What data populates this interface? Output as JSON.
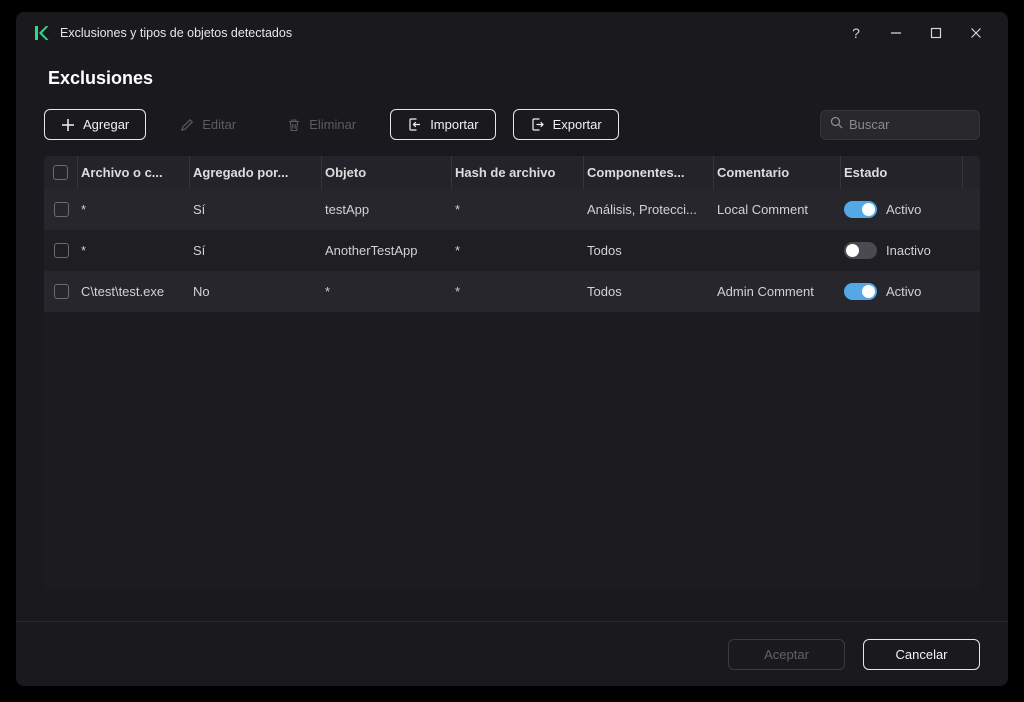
{
  "window": {
    "title": "Exclusiones y tipos de objetos detectados",
    "help_label": "?"
  },
  "page": {
    "title": "Exclusiones"
  },
  "toolbar": {
    "add_label": "Agregar",
    "edit_label": "Editar",
    "delete_label": "Eliminar",
    "import_label": "Importar",
    "export_label": "Exportar",
    "search_placeholder": "Buscar"
  },
  "table": {
    "columns": [
      "Archivo o c...",
      "Agregado por...",
      "Objeto",
      "Hash de archivo",
      "Componentes...",
      "Comentario",
      "Estado"
    ],
    "rows": [
      {
        "file": "*",
        "added_by": "Sí",
        "object": "testApp",
        "hash": "*",
        "components": "Análisis, Protecci...",
        "comment": "Local Comment",
        "state": "Activo"
      },
      {
        "file": "*",
        "added_by": "Sí",
        "object": "AnotherTestApp",
        "hash": "*",
        "components": "Todos",
        "comment": "",
        "state": "Inactivo"
      },
      {
        "file": "C\\test\\test.exe",
        "added_by": "No",
        "object": "*",
        "hash": "*",
        "components": "Todos",
        "comment": "Admin Comment",
        "state": "Activo"
      }
    ]
  },
  "footer": {
    "accept_label": "Aceptar",
    "cancel_label": "Cancelar"
  },
  "colors": {
    "brand_green": "#2fd987",
    "toggle_on_blue": "#55a8e6"
  }
}
